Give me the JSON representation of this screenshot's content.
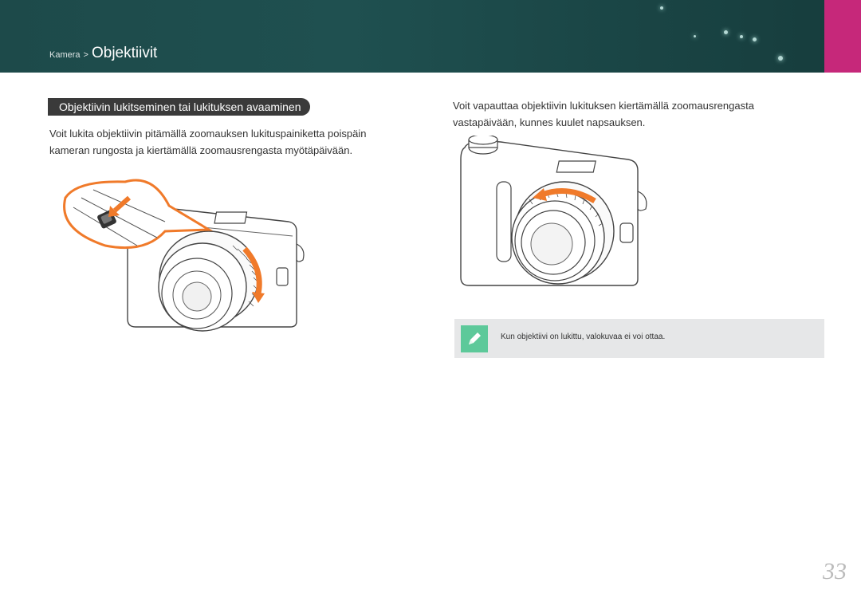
{
  "header": {
    "breadcrumb_parent": "Kamera",
    "breadcrumb_separator": ">",
    "breadcrumb_current": "Objektiivit",
    "accent_color": "#c6287a",
    "background_color": "#1f5050"
  },
  "section": {
    "title": "Objektiivin lukitseminen tai lukituksen avaaminen"
  },
  "left_column": {
    "text": "Voit lukita objektiivin pitämällä zoomauksen lukituspainiketta poispäin kameran rungosta ja kiertämällä zoomausrengasta myötäpäivään.",
    "illustration": "camera-lock-zoom-ring-illustration"
  },
  "right_column": {
    "text": "Voit vapauttaa objektiivin lukituksen kiertämällä zoomausrengasta vastapäivään, kunnes kuulet napsauksen.",
    "illustration": "camera-unlock-zoom-ring-illustration"
  },
  "note": {
    "icon": "pencil-note-icon",
    "icon_color": "#5dc99a",
    "text": "Kun objektiivi on lukittu, valokuvaa ei voi ottaa."
  },
  "page_number": "33"
}
